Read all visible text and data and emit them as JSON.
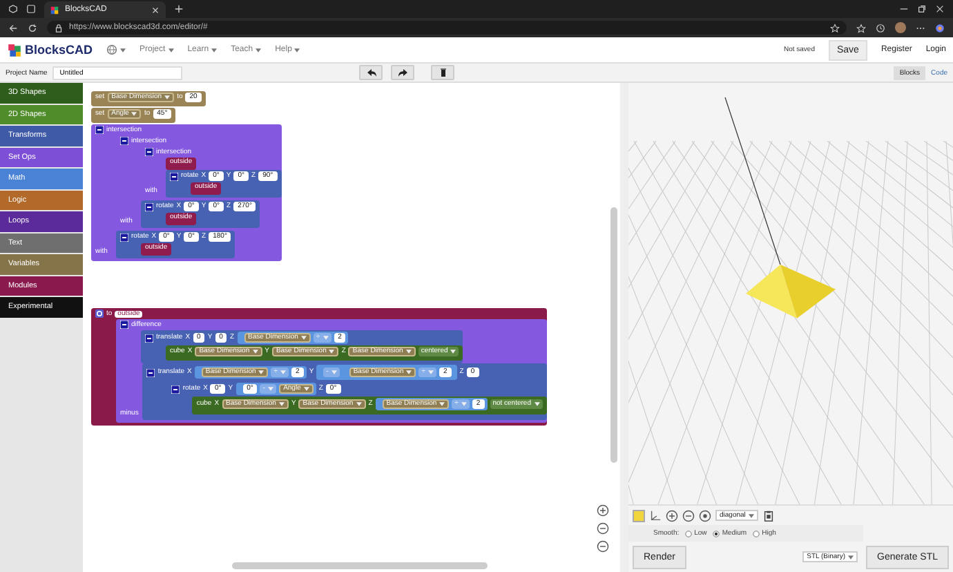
{
  "browser": {
    "tab_title": "BlocksCAD",
    "url": "https://www.blockscad3d.com/editor/#"
  },
  "header": {
    "logo": "BlocksCAD",
    "menus": [
      "Project",
      "Learn",
      "Teach",
      "Help"
    ],
    "save_status": "Not saved",
    "buttons": [
      "Save",
      "Register",
      "Login"
    ]
  },
  "project": {
    "label": "Project Name",
    "value": "Untitled"
  },
  "view_tabs": [
    {
      "label": "Blocks",
      "selected": true
    },
    {
      "label": "Code",
      "selected": false
    }
  ],
  "toolbox": [
    {
      "label": "3D Shapes",
      "color": "#2f5e1c"
    },
    {
      "label": "2D Shapes",
      "color": "#4f8c2a"
    },
    {
      "label": "Transforms",
      "color": "#3f5aa6"
    },
    {
      "label": "Set Ops",
      "color": "#7d4fd6"
    },
    {
      "label": "Math",
      "color": "#4a82d6"
    },
    {
      "label": "Logic",
      "color": "#b2692a"
    },
    {
      "label": "Loops",
      "color": "#5b2b9c"
    },
    {
      "label": "Text",
      "color": "#6f6f6f"
    },
    {
      "label": "Variables",
      "color": "#857349"
    },
    {
      "label": "Modules",
      "color": "#8a1a4d"
    },
    {
      "label": "Experimental",
      "color": "#111111"
    }
  ],
  "workspace": {
    "stacks": [
      {
        "blocks": [
          {
            "kind": "variables",
            "line": [
              {
                "kind": "text",
                "text": "set"
              },
              {
                "kind": "var",
                "text": "Base Dimension"
              },
              {
                "kind": "text",
                "text": "to"
              },
              {
                "kind": "num",
                "text": "20"
              }
            ]
          },
          {
            "kind": "variables",
            "line": [
              {
                "kind": "text",
                "text": "set"
              },
              {
                "kind": "var",
                "text": "Angle"
              },
              {
                "kind": "text",
                "text": "to"
              },
              {
                "kind": "num",
                "text": "45°"
              }
            ]
          },
          {
            "kind": "setops",
            "line": [
              {
                "kind": "toggle"
              },
              {
                "kind": "text",
                "text": "intersection"
              }
            ],
            "slots": [
              {
                "blocks": [
                  {
                    "kind": "setops",
                    "line": [
                      {
                        "kind": "toggle"
                      },
                      {
                        "kind": "text",
                        "text": "intersection"
                      }
                    ],
                    "slots": [
                      {
                        "blocks": [
                          {
                            "kind": "setops",
                            "line": [
                              {
                                "kind": "toggle"
                              },
                              {
                                "kind": "text",
                                "text": "intersection"
                              }
                            ],
                            "slots": [
                              {
                                "blocks": [
                                  {
                                    "kind": "module",
                                    "line": [
                                      {
                                        "kind": "text",
                                        "text": "outside"
                                      }
                                    ]
                                  }
                                ]
                              },
                              {
                                "label": "with",
                                "blocks": [
                                  {
                                    "kind": "transforms",
                                    "line": [
                                      {
                                        "kind": "toggle"
                                      },
                                      {
                                        "kind": "text",
                                        "text": "rotate"
                                      },
                                      {
                                        "kind": "text",
                                        "text": "X"
                                      },
                                      {
                                        "kind": "num",
                                        "text": "0°"
                                      },
                                      {
                                        "kind": "text",
                                        "text": "Y"
                                      },
                                      {
                                        "kind": "num",
                                        "text": "0°"
                                      },
                                      {
                                        "kind": "text",
                                        "text": "Z"
                                      },
                                      {
                                        "kind": "num",
                                        "text": "90°"
                                      }
                                    ],
                                    "slots": [
                                      {
                                        "blocks": [
                                          {
                                            "kind": "module",
                                            "line": [
                                              {
                                                "kind": "text",
                                                "text": "outside"
                                              }
                                            ]
                                          }
                                        ]
                                      }
                                    ]
                                  }
                                ]
                              }
                            ]
                          }
                        ]
                      },
                      {
                        "label": "with",
                        "blocks": [
                          {
                            "kind": "transforms",
                            "line": [
                              {
                                "kind": "toggle"
                              },
                              {
                                "kind": "text",
                                "text": "rotate"
                              },
                              {
                                "kind": "text",
                                "text": "X"
                              },
                              {
                                "kind": "num",
                                "text": "0°"
                              },
                              {
                                "kind": "text",
                                "text": "Y"
                              },
                              {
                                "kind": "num",
                                "text": "0°"
                              },
                              {
                                "kind": "text",
                                "text": "Z"
                              },
                              {
                                "kind": "num",
                                "text": "270°"
                              }
                            ],
                            "slots": [
                              {
                                "blocks": [
                                  {
                                    "kind": "module",
                                    "line": [
                                      {
                                        "kind": "text",
                                        "text": "outside"
                                      }
                                    ]
                                  }
                                ]
                              }
                            ]
                          }
                        ]
                      }
                    ]
                  }
                ]
              },
              {
                "label": "with",
                "blocks": [
                  {
                    "kind": "transforms",
                    "line": [
                      {
                        "kind": "toggle"
                      },
                      {
                        "kind": "text",
                        "text": "rotate"
                      },
                      {
                        "kind": "text",
                        "text": "X"
                      },
                      {
                        "kind": "num",
                        "text": "0°"
                      },
                      {
                        "kind": "text",
                        "text": "Y"
                      },
                      {
                        "kind": "num",
                        "text": "0°"
                      },
                      {
                        "kind": "text",
                        "text": "Z"
                      },
                      {
                        "kind": "num",
                        "text": "180°"
                      }
                    ],
                    "slots": [
                      {
                        "blocks": [
                          {
                            "kind": "module",
                            "line": [
                              {
                                "kind": "text",
                                "text": "outside"
                              }
                            ]
                          }
                        ]
                      }
                    ]
                  }
                ]
              }
            ]
          }
        ]
      },
      {
        "blocks": [
          {
            "kind": "procedure",
            "line": [
              {
                "kind": "gear"
              },
              {
                "kind": "text",
                "text": "to"
              },
              {
                "kind": "name",
                "text": "outside"
              }
            ],
            "slots": [
              {
                "blocks": [
                  {
                    "kind": "setops",
                    "line": [
                      {
                        "kind": "toggle"
                      },
                      {
                        "kind": "text",
                        "text": "difference"
                      }
                    ],
                    "slots": [
                      {
                        "blocks": [
                          {
                            "kind": "transforms",
                            "line": [
                              {
                                "kind": "toggle"
                              },
                              {
                                "kind": "text",
                                "text": "translate"
                              },
                              {
                                "kind": "text",
                                "text": "X"
                              },
                              {
                                "kind": "num",
                                "text": "0"
                              },
                              {
                                "kind": "text",
                                "text": "Y"
                              },
                              {
                                "kind": "num",
                                "text": "0"
                              },
                              {
                                "kind": "text",
                                "text": "Z"
                              },
                              {
                                "kind": "expr",
                                "items": [
                                  {
                                    "kind": "var",
                                    "text": "Base Dimension"
                                  },
                                  {
                                    "kind": "op",
                                    "text": "÷"
                                  },
                                  {
                                    "kind": "num",
                                    "text": "2"
                                  }
                                ]
                              }
                            ],
                            "slots": [
                              {
                                "blocks": [
                                  {
                                    "kind": "shapes",
                                    "line": [
                                      {
                                        "kind": "text",
                                        "text": "cube"
                                      },
                                      {
                                        "kind": "text",
                                        "text": "X"
                                      },
                                      {
                                        "kind": "var",
                                        "text": "Base Dimension"
                                      },
                                      {
                                        "kind": "text",
                                        "text": "Y"
                                      },
                                      {
                                        "kind": "var",
                                        "text": "Base Dimension"
                                      },
                                      {
                                        "kind": "text",
                                        "text": "Z"
                                      },
                                      {
                                        "kind": "var",
                                        "text": "Base Dimension"
                                      },
                                      {
                                        "kind": "drop",
                                        "text": "centered"
                                      }
                                    ]
                                  }
                                ]
                              }
                            ]
                          }
                        ]
                      },
                      {
                        "label": "minus",
                        "blocks": [
                          {
                            "kind": "transforms",
                            "line": [
                              {
                                "kind": "toggle"
                              },
                              {
                                "kind": "text",
                                "text": "translate"
                              },
                              {
                                "kind": "text",
                                "text": "X"
                              },
                              {
                                "kind": "expr",
                                "items": [
                                  {
                                    "kind": "var",
                                    "text": "Base Dimension"
                                  },
                                  {
                                    "kind": "op",
                                    "text": "÷"
                                  },
                                  {
                                    "kind": "num",
                                    "text": "2"
                                  }
                                ]
                              },
                              {
                                "kind": "text",
                                "text": "Y"
                              },
                              {
                                "kind": "expr",
                                "items": [
                                  {
                                    "kind": "op",
                                    "text": "-"
                                  },
                                  {
                                    "kind": "expr",
                                    "items": [
                                      {
                                        "kind": "var",
                                        "text": "Base Dimension"
                                      },
                                      {
                                        "kind": "op",
                                        "text": "÷"
                                      },
                                      {
                                        "kind": "num",
                                        "text": "2"
                                      }
                                    ]
                                  }
                                ]
                              },
                              {
                                "kind": "text",
                                "text": "Z"
                              },
                              {
                                "kind": "num",
                                "text": "0"
                              }
                            ],
                            "slots": [
                              {
                                "blocks": [
                                  {
                                    "kind": "transforms",
                                    "line": [
                                      {
                                        "kind": "toggle"
                                      },
                                      {
                                        "kind": "text",
                                        "text": "rotate"
                                      },
                                      {
                                        "kind": "text",
                                        "text": "X"
                                      },
                                      {
                                        "kind": "num",
                                        "text": "0°"
                                      },
                                      {
                                        "kind": "text",
                                        "text": "Y"
                                      },
                                      {
                                        "kind": "expr",
                                        "items": [
                                          {
                                            "kind": "num",
                                            "text": "0°"
                                          },
                                          {
                                            "kind": "op",
                                            "text": "-"
                                          },
                                          {
                                            "kind": "var",
                                            "text": "Angle"
                                          }
                                        ]
                                      },
                                      {
                                        "kind": "text",
                                        "text": "Z"
                                      },
                                      {
                                        "kind": "num",
                                        "text": "0°"
                                      }
                                    ],
                                    "slots": [
                                      {
                                        "blocks": [
                                          {
                                            "kind": "shapes",
                                            "line": [
                                              {
                                                "kind": "text",
                                                "text": "cube"
                                              },
                                              {
                                                "kind": "text",
                                                "text": "X"
                                              },
                                              {
                                                "kind": "var",
                                                "text": "Base Dimension"
                                              },
                                              {
                                                "kind": "text",
                                                "text": "Y"
                                              },
                                              {
                                                "kind": "var",
                                                "text": "Base Dimension"
                                              },
                                              {
                                                "kind": "text",
                                                "text": "Z"
                                              },
                                              {
                                                "kind": "expr",
                                                "items": [
                                                  {
                                                    "kind": "var",
                                                    "text": "Base Dimension"
                                                  },
                                                  {
                                                    "kind": "op",
                                                    "text": "÷"
                                                  },
                                                  {
                                                    "kind": "num",
                                                    "text": "2"
                                                  }
                                                ]
                                              },
                                              {
                                                "kind": "drop",
                                                "text": "not centered"
                                              }
                                            ]
                                          }
                                        ]
                                      }
                                    ]
                                  }
                                ]
                              }
                            ]
                          }
                        ]
                      }
                    ]
                  }
                ]
              }
            ]
          }
        ]
      }
    ]
  },
  "viewer": {
    "view_select": "diagonal",
    "smooth": {
      "label": "Smooth:",
      "options": [
        {
          "label": "Low",
          "selected": false
        },
        {
          "label": "Medium",
          "selected": true
        },
        {
          "label": "High",
          "selected": false
        }
      ]
    },
    "render_button": "Render",
    "format_select": "STL (Binary)",
    "generate_button": "Generate STL"
  }
}
